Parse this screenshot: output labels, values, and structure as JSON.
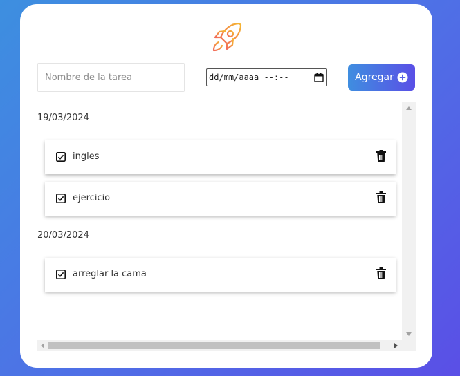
{
  "form": {
    "task_placeholder": "Nombre de la tarea",
    "date_placeholder": "dd/mm/aaaa --:--",
    "add_label": "Agregar"
  },
  "groups": [
    {
      "date": "19/03/2024",
      "tasks": [
        {
          "label": "ingles",
          "done": true
        },
        {
          "label": "ejercicio",
          "done": true
        }
      ]
    },
    {
      "date": "20/03/2024",
      "tasks": [
        {
          "label": "arreglar la cama",
          "done": true
        }
      ]
    }
  ],
  "colors": {
    "logo": "#f5a623",
    "button_start": "#3f8ee0",
    "button_end": "#5a4fe6"
  },
  "icons": [
    "rocket-icon",
    "calendar-icon",
    "plus-circle-icon",
    "checkbox-icon",
    "trash-icon"
  ]
}
